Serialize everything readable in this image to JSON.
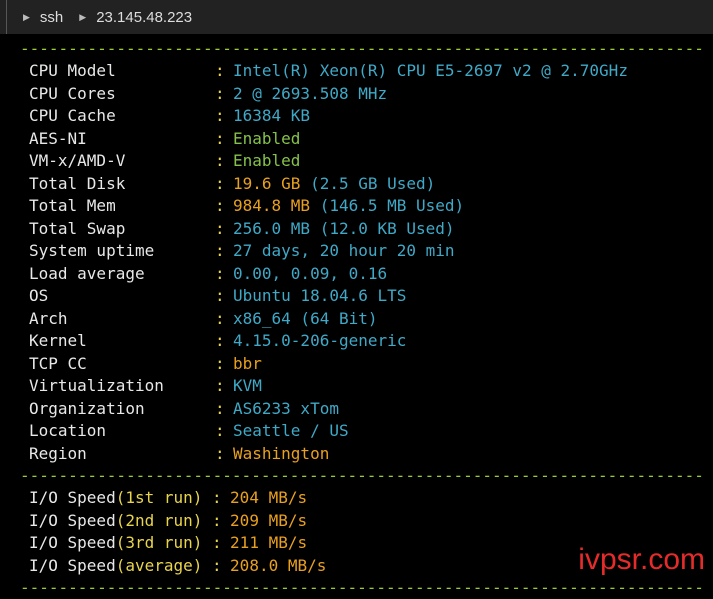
{
  "tabbar": {
    "tab1": "ssh",
    "tab2": "23.145.48.223"
  },
  "separator": "-----------------------------------------------------------------------",
  "info": [
    {
      "label": "CPU Model",
      "value": "Intel(R) Xeon(R) CPU E5-2697 v2 @ 2.70GHz",
      "color": "cyan"
    },
    {
      "label": "CPU Cores",
      "value": "2 @ 2693.508 MHz",
      "color": "cyan"
    },
    {
      "label": "CPU Cache",
      "value": "16384 KB",
      "color": "cyan"
    },
    {
      "label": "AES-NI",
      "value": "Enabled",
      "color": "green"
    },
    {
      "label": "VM-x/AMD-V",
      "value": "Enabled",
      "color": "green"
    },
    {
      "label": "Total Disk",
      "value": "19.6 GB",
      "extra": " (2.5 GB Used)",
      "color": "yellow"
    },
    {
      "label": "Total Mem",
      "value": "984.8 MB",
      "extra": " (146.5 MB Used)",
      "color": "yellow"
    },
    {
      "label": "Total Swap",
      "value": "256.0 MB (12.0 KB Used)",
      "color": "cyan"
    },
    {
      "label": "System uptime",
      "value": "27 days, 20 hour 20 min",
      "color": "cyan"
    },
    {
      "label": "Load average",
      "value": "0.00, 0.09, 0.16",
      "color": "cyan"
    },
    {
      "label": "OS",
      "value": "Ubuntu 18.04.6 LTS",
      "color": "cyan"
    },
    {
      "label": "Arch",
      "value": "x86_64 (64 Bit)",
      "color": "cyan"
    },
    {
      "label": "Kernel",
      "value": "4.15.0-206-generic",
      "color": "cyan"
    },
    {
      "label": "TCP CC",
      "value": "bbr",
      "color": "yellow"
    },
    {
      "label": "Virtualization",
      "value": "KVM",
      "color": "cyan"
    },
    {
      "label": "Organization",
      "value": "AS6233 xTom",
      "color": "cyan"
    },
    {
      "label": "Location",
      "value": "Seattle / US",
      "color": "cyan"
    },
    {
      "label": "Region",
      "value": "Washington",
      "color": "yellow"
    }
  ],
  "io": [
    {
      "prefix": "I/O Speed",
      "paren": "(1st run)",
      "pad": " ",
      "value": "204 MB/s"
    },
    {
      "prefix": "I/O Speed",
      "paren": "(2nd run)",
      "pad": " ",
      "value": "209 MB/s"
    },
    {
      "prefix": "I/O Speed",
      "paren": "(3rd run)",
      "pad": " ",
      "value": "211 MB/s"
    },
    {
      "prefix": "I/O Speed",
      "paren": "(average)",
      "pad": " ",
      "value": "208.0 MB/s"
    }
  ],
  "colon": ":",
  "watermark": "ivpsr.com",
  "colors": {
    "cyan": "#3fa9c7",
    "green": "#86c24a",
    "yellow": "#e8a020",
    "separator": "#9acd32"
  }
}
